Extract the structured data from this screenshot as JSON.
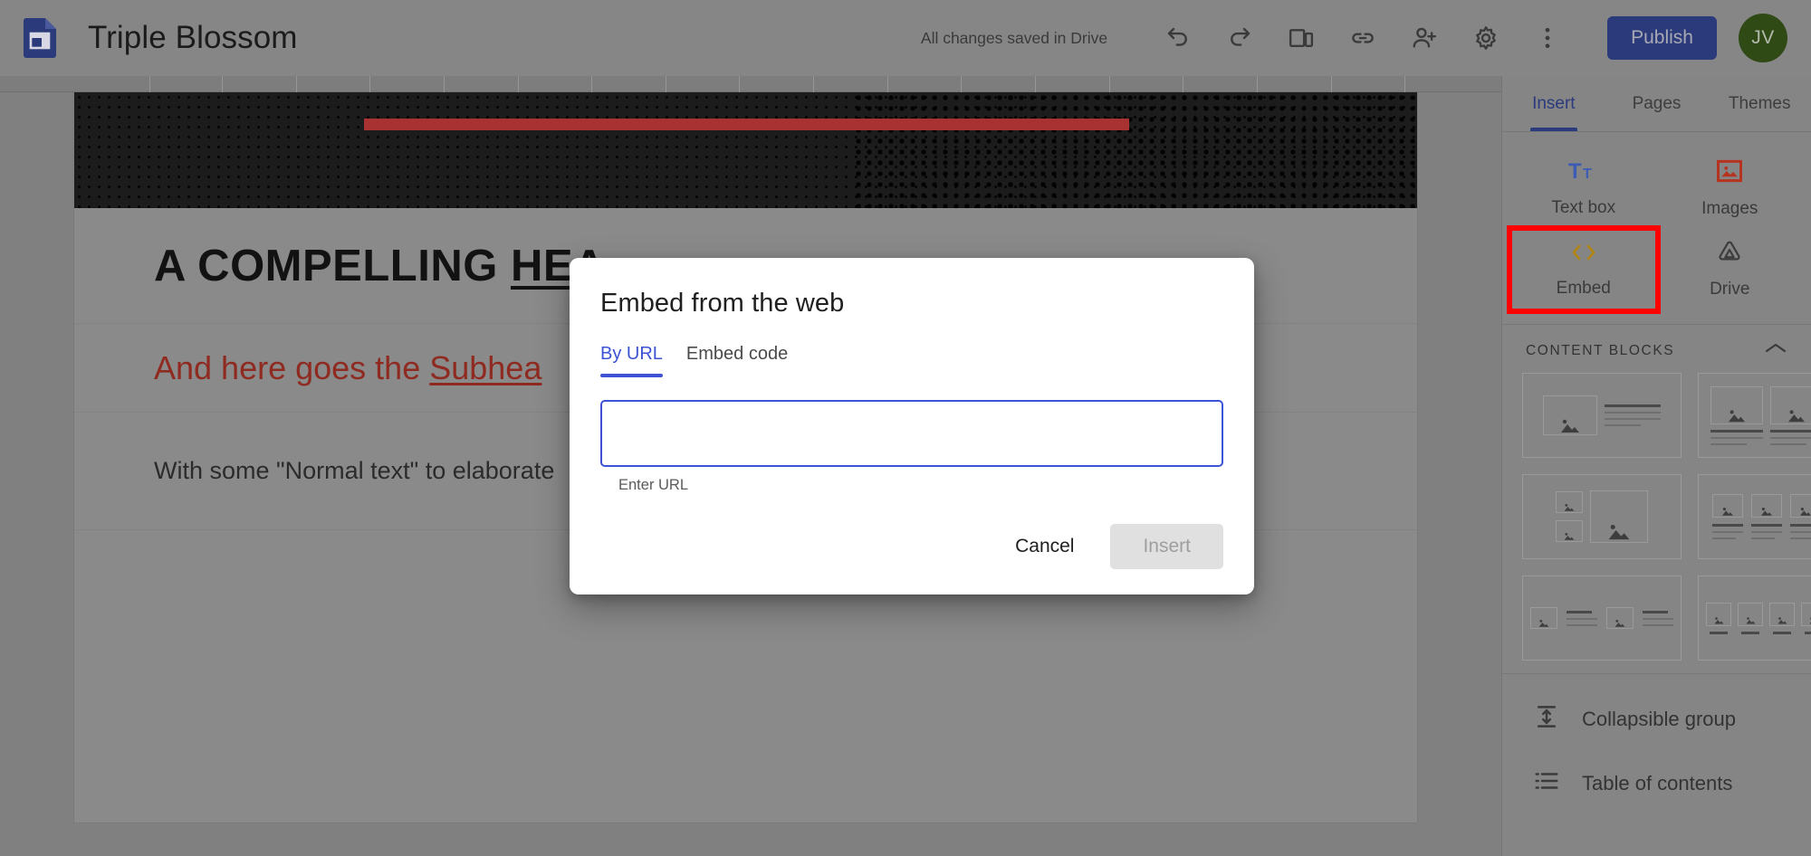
{
  "topbar": {
    "doc_icon": "google-sites-file-icon",
    "title": "Triple Blossom",
    "save_status": "All changes saved in Drive",
    "icons": [
      {
        "name": "undo-icon",
        "label": "Undo"
      },
      {
        "name": "redo-icon",
        "label": "Redo"
      },
      {
        "name": "preview-icon",
        "label": "Preview"
      },
      {
        "name": "link-icon",
        "label": "Copy page link"
      },
      {
        "name": "add-person-icon",
        "label": "Share with others"
      },
      {
        "name": "gear-icon",
        "label": "Settings"
      },
      {
        "name": "more-vert-icon",
        "label": "More"
      }
    ],
    "publish_label": "Publish",
    "avatar_initials": "JV",
    "colors": {
      "publish_bg": "#2b3a7a",
      "avatar_bg": "#2f4a14"
    }
  },
  "canvas": {
    "banner": {
      "name": "page-header-banner",
      "accent_bar_color": "#a83232"
    },
    "heading_plain": "A COMPELLING ",
    "heading_underlined": "HEA",
    "subheading_plain": "And here goes the ",
    "subheading_underlined": "Subhea",
    "body_text": "With some \"Normal text\" to elaborate ",
    "heading_color": "#121212",
    "subheading_color": "#8f2a21"
  },
  "sidebar": {
    "tabs": [
      {
        "label": "Insert",
        "active": true
      },
      {
        "label": "Pages",
        "active": false
      },
      {
        "label": "Themes",
        "active": false
      }
    ],
    "insert_items": [
      {
        "label": "Text box",
        "icon": "text-box-icon",
        "highlighted": false
      },
      {
        "label": "Images",
        "icon": "images-icon",
        "highlighted": false
      },
      {
        "label": "Embed",
        "icon": "embed-code-icon",
        "highlighted": true
      },
      {
        "label": "Drive",
        "icon": "google-drive-icon",
        "highlighted": false
      }
    ],
    "content_blocks": {
      "title": "CONTENT BLOCKS",
      "collapse_icon": "chevron-up-icon",
      "layouts": [
        {
          "name": "layout-image-left-text-right"
        },
        {
          "name": "layout-two-images-with-text"
        },
        {
          "name": "layout-two-small-one-large-image"
        },
        {
          "name": "layout-three-column-text"
        },
        {
          "name": "layout-two-image-text-pairs"
        },
        {
          "name": "layout-four-images-captions"
        }
      ]
    },
    "list_items": [
      {
        "label": "Collapsible group",
        "icon": "collapsible-group-icon"
      },
      {
        "label": "Table of contents",
        "icon": "table-of-contents-icon"
      }
    ],
    "highlight_color": "#ff0000"
  },
  "dialog": {
    "title": "Embed from the web",
    "tabs": [
      {
        "label": "By URL",
        "active": true
      },
      {
        "label": "Embed code",
        "active": false
      }
    ],
    "url_value": "",
    "url_placeholder": "",
    "helper_text": "Enter URL",
    "cancel_label": "Cancel",
    "insert_label": "Insert",
    "accent_color": "#3b53d4"
  }
}
